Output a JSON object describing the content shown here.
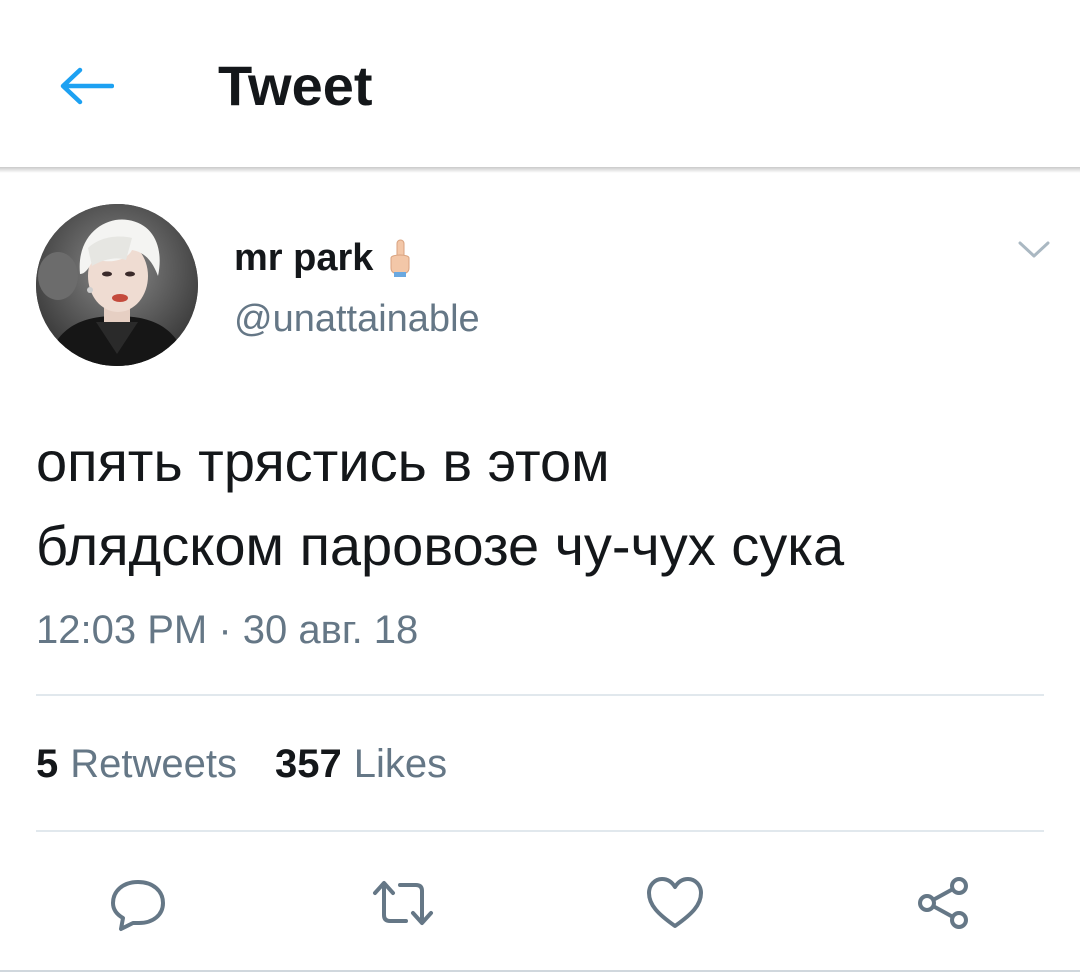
{
  "header": {
    "title": "Tweet",
    "back_icon": "arrow-left-icon",
    "accent_color": "#1da1f2"
  },
  "tweet": {
    "author": {
      "display_name": "mr park",
      "name_emoji": "middle-finger-emoji",
      "handle": "@unattainable",
      "avatar": "avatar-photo"
    },
    "text": "опять трястись в этом\nблядском паровозе чу-чух сука",
    "timestamp": "12:03 PM · 30 авг. 18",
    "stats": {
      "retweets_count": "5",
      "retweets_label": "Retweets",
      "likes_count": "357",
      "likes_label": "Likes"
    },
    "actions": [
      {
        "name": "reply",
        "icon": "reply-icon"
      },
      {
        "name": "retweet",
        "icon": "retweet-icon"
      },
      {
        "name": "like",
        "icon": "heart-icon"
      },
      {
        "name": "share",
        "icon": "share-icon"
      }
    ],
    "menu_icon": "chevron-down-icon"
  },
  "colors": {
    "text_primary": "#14171a",
    "text_secondary": "#657786",
    "divider": "#e1e8ed"
  }
}
